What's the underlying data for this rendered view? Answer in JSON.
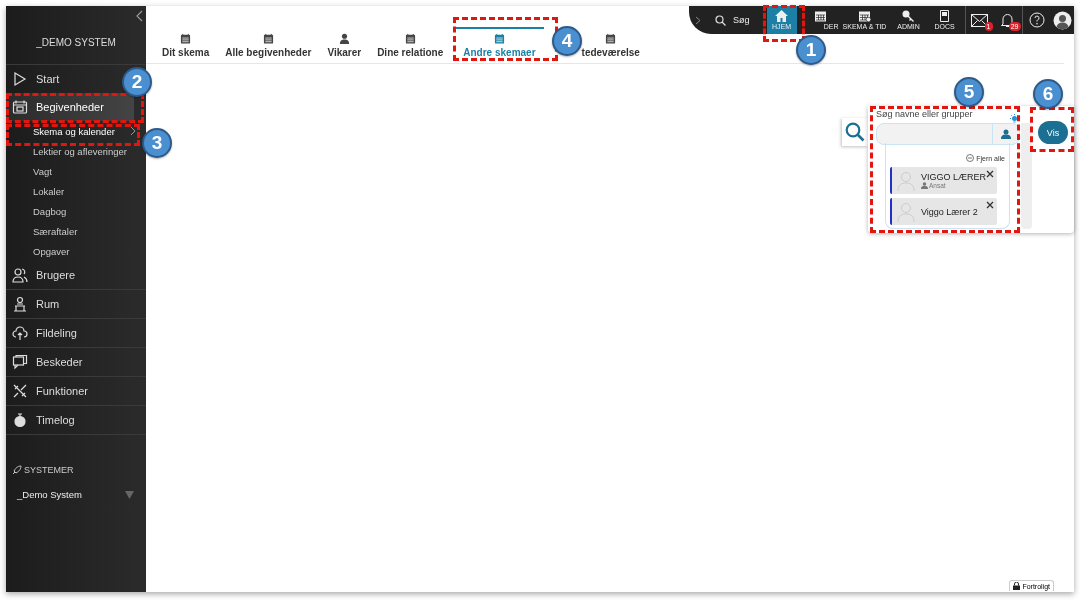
{
  "sidebar": {
    "brand": "_DEMO SYSTEM",
    "items": [
      {
        "label": "Start",
        "selected": false
      },
      {
        "label": "Begivenheder",
        "selected": true,
        "children": [
          {
            "label": "Skema og kalender",
            "selected": true
          },
          {
            "label": "Lektier og afleveringer",
            "selected": false
          },
          {
            "label": "Vagt",
            "selected": false
          },
          {
            "label": "Lokaler",
            "selected": false
          },
          {
            "label": "Dagbog",
            "selected": false
          },
          {
            "label": "Særaftaler",
            "selected": false
          },
          {
            "label": "Opgaver",
            "selected": false
          }
        ]
      },
      {
        "label": "Brugere",
        "selected": false
      },
      {
        "label": "Rum",
        "selected": false
      },
      {
        "label": "Fildeling",
        "selected": false
      },
      {
        "label": "Beskeder",
        "selected": false
      },
      {
        "label": "Funktioner",
        "selected": false
      },
      {
        "label": "Timelog",
        "selected": false
      }
    ],
    "systems_heading": "SYSTEMER",
    "system": "_Demo System"
  },
  "tabs": [
    {
      "label": "Dit skema",
      "selected": false
    },
    {
      "label": "Alle begivenheder",
      "selected": false
    },
    {
      "label": "Vikarer",
      "selected": false
    },
    {
      "label": "Dine relatione",
      "selected": false
    },
    {
      "label": "Andre skemaer",
      "selected": true
    },
    {
      "label": "tedeværelse",
      "selected": false
    }
  ],
  "topbar": {
    "search": "Søg",
    "items": [
      {
        "label": "HJEM",
        "selected": true
      },
      {
        "label": "DER",
        "selected": false
      },
      {
        "label": "SKEMA & TID",
        "selected": false
      },
      {
        "label": "ADMIN",
        "selected": false
      },
      {
        "label": "DOCS",
        "selected": false
      }
    ],
    "mail_badge": "1",
    "bell_badge": "29"
  },
  "search_panel": {
    "label": "Søg navne eller grupper",
    "remove_all": "Fjern alle",
    "people": [
      {
        "name": "VIGGO LÆRER",
        "role": "Ansat"
      },
      {
        "name": "Viggo Lærer 2"
      }
    ],
    "button": "Vis"
  },
  "footer": {
    "confidential": "Fortroligt"
  },
  "callouts": [
    {
      "number": "1"
    },
    {
      "number": "2"
    },
    {
      "number": "3"
    },
    {
      "number": "4"
    },
    {
      "number": "5"
    },
    {
      "number": "6"
    }
  ]
}
